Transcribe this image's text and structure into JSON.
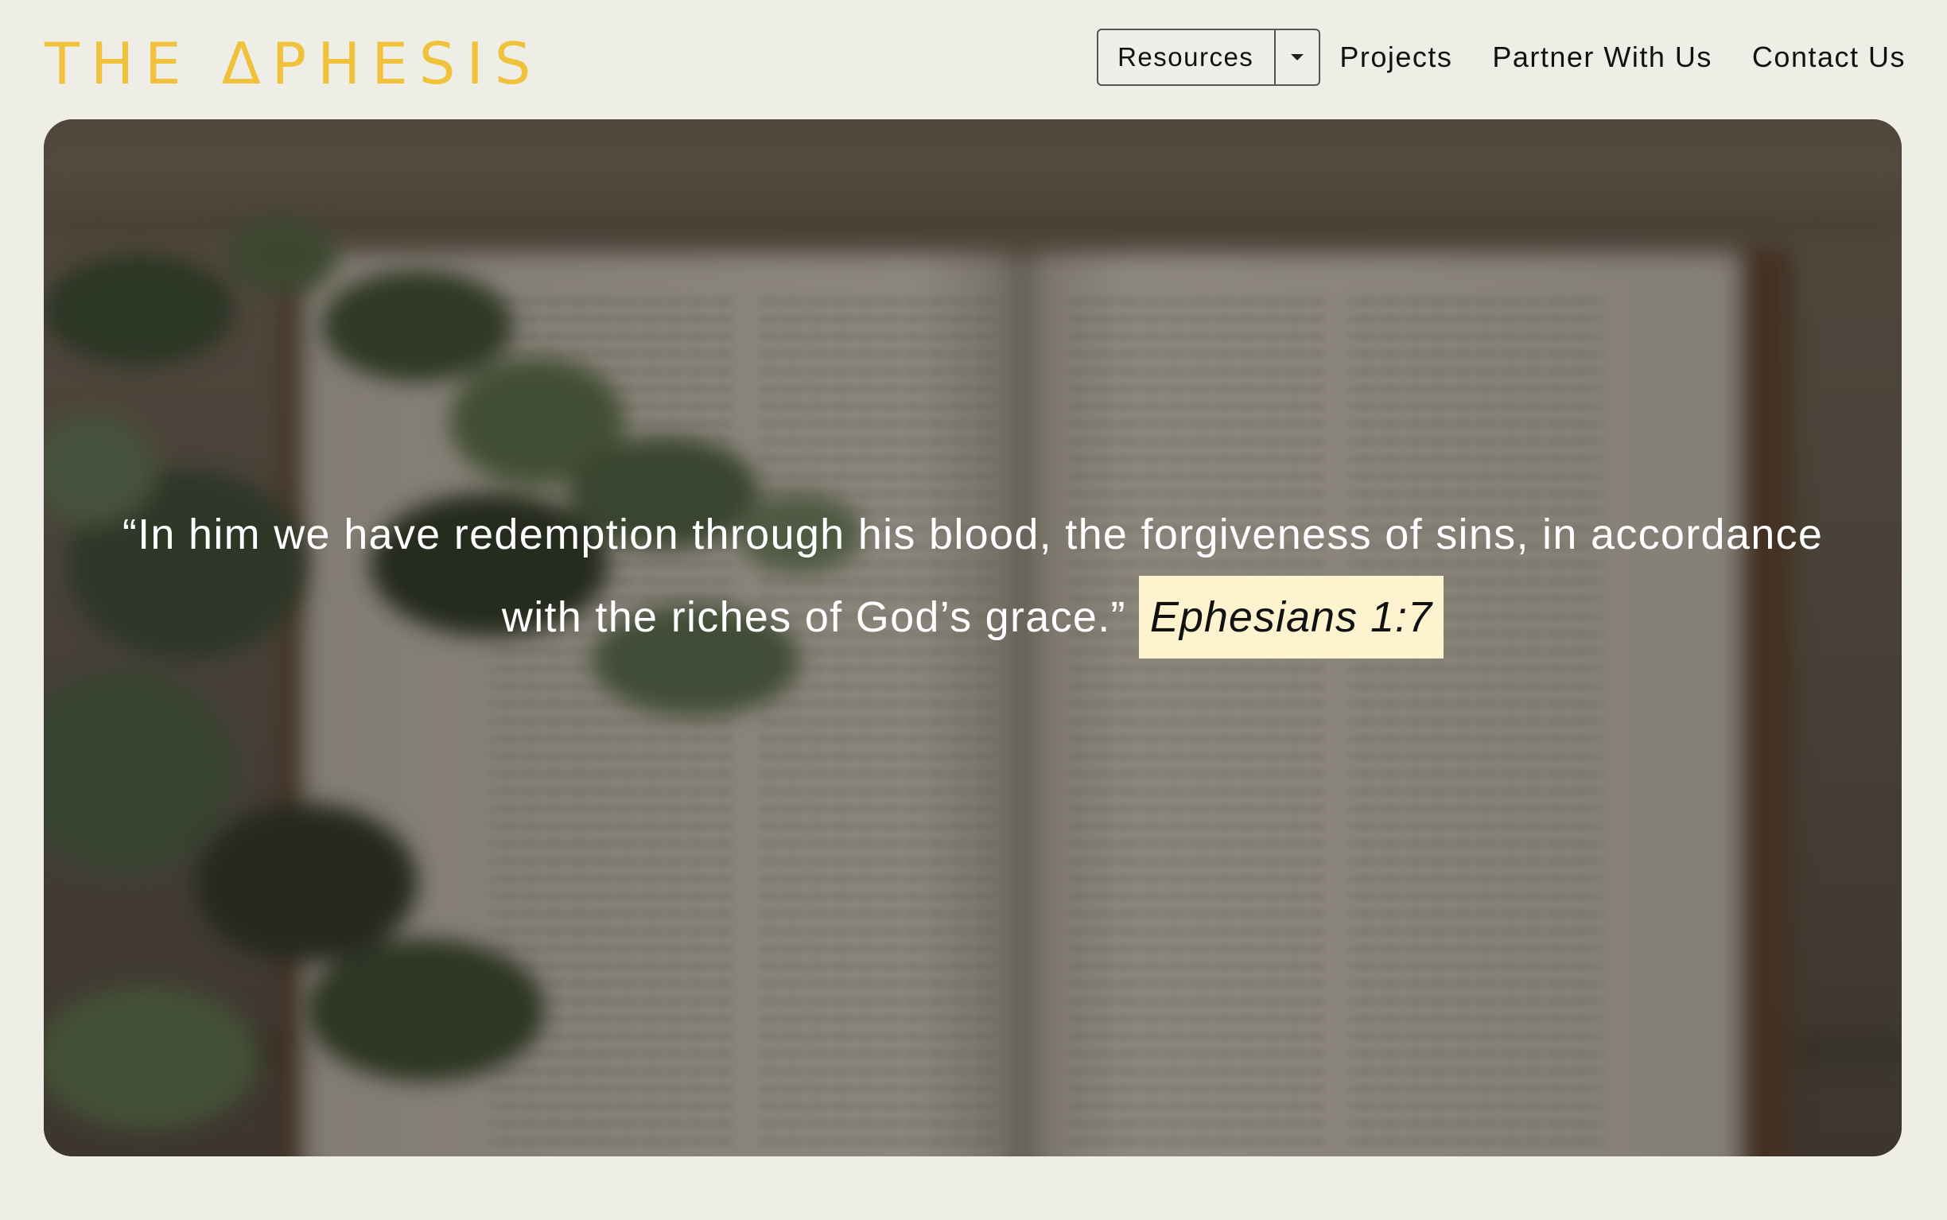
{
  "brand": {
    "logo_text": "THE ΔPHESIS",
    "accent_color": "#f0c23c"
  },
  "nav": {
    "resources_label": "Resources",
    "dropdown_icon": "caret-down-icon",
    "links": [
      "Projects",
      "Partner With Us",
      "Contact Us"
    ]
  },
  "hero": {
    "quote": "“In him we have redemption through his blood, the forgiveness of sins, in accordance with the riches of God’s grace.”",
    "reference": "Ephesians 1:7",
    "reference_bg": "#fdf3cf"
  }
}
